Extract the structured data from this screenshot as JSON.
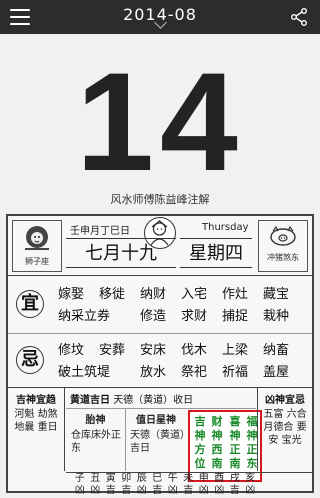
{
  "topbar": {
    "title": "2014-08",
    "menu_icon": "menu-icon",
    "share_icon": "share-icon"
  },
  "day": {
    "number": "14",
    "annotation": "风水师傅陈益峰注解"
  },
  "header": {
    "zodiac_sign": "狮子座",
    "ganzhi": "壬申月丁巳日",
    "weekday_en": "Thursday",
    "lunar_date": "七月十九",
    "weekday": "星期四",
    "clash": "冲猪煞东"
  },
  "yi": {
    "seal": "宜",
    "items": [
      "嫁娶",
      "移徙",
      "纳财",
      "入宅",
      "作灶",
      "藏宝",
      "纳采立券",
      "",
      "修造",
      "求财",
      "捕捉",
      "栽种"
    ]
  },
  "ji": {
    "seal": "忌",
    "items": [
      "修坟",
      "安葬",
      "安床",
      "伐木",
      "上梁",
      "纳畜",
      "破土筑堤",
      "",
      "放水",
      "祭祀",
      "祈福",
      "盖屋"
    ]
  },
  "lower": {
    "left_title": "吉神宜趋",
    "left_body": "河魁 劫煞 地曩 重日",
    "huangdao_label": "黄道吉日",
    "huangdao_value": "天德（黄道）收日",
    "taishen_title": "胎神",
    "taishen_body": "仓库床外正东",
    "xingshen_title": "值日星神",
    "xingshen_body": "天德（黄道）吉日",
    "right_title": "凶神宜忌",
    "right_body": "五富 六合 月德合 要安 宝光",
    "directions": [
      [
        "吉",
        "神",
        "方",
        "位"
      ],
      [
        "财",
        "神",
        "西",
        "南"
      ],
      [
        "喜",
        "神",
        "正",
        "南"
      ],
      [
        "福",
        "神",
        "正",
        "东"
      ]
    ],
    "branches": [
      "子",
      "丑",
      "寅",
      "卯",
      "辰",
      "巳",
      "午",
      "未",
      "申",
      "酉",
      "戌",
      "亥"
    ],
    "branch_luck": [
      "凶",
      "凶",
      "吉",
      "吉",
      "凶",
      "吉",
      "凶",
      "吉",
      "凶",
      "凶",
      "吉",
      "凶"
    ]
  },
  "colors": {
    "topbar": "#2c2c2c",
    "direction_border": "#d7171e",
    "direction_text": "#198a2a"
  }
}
